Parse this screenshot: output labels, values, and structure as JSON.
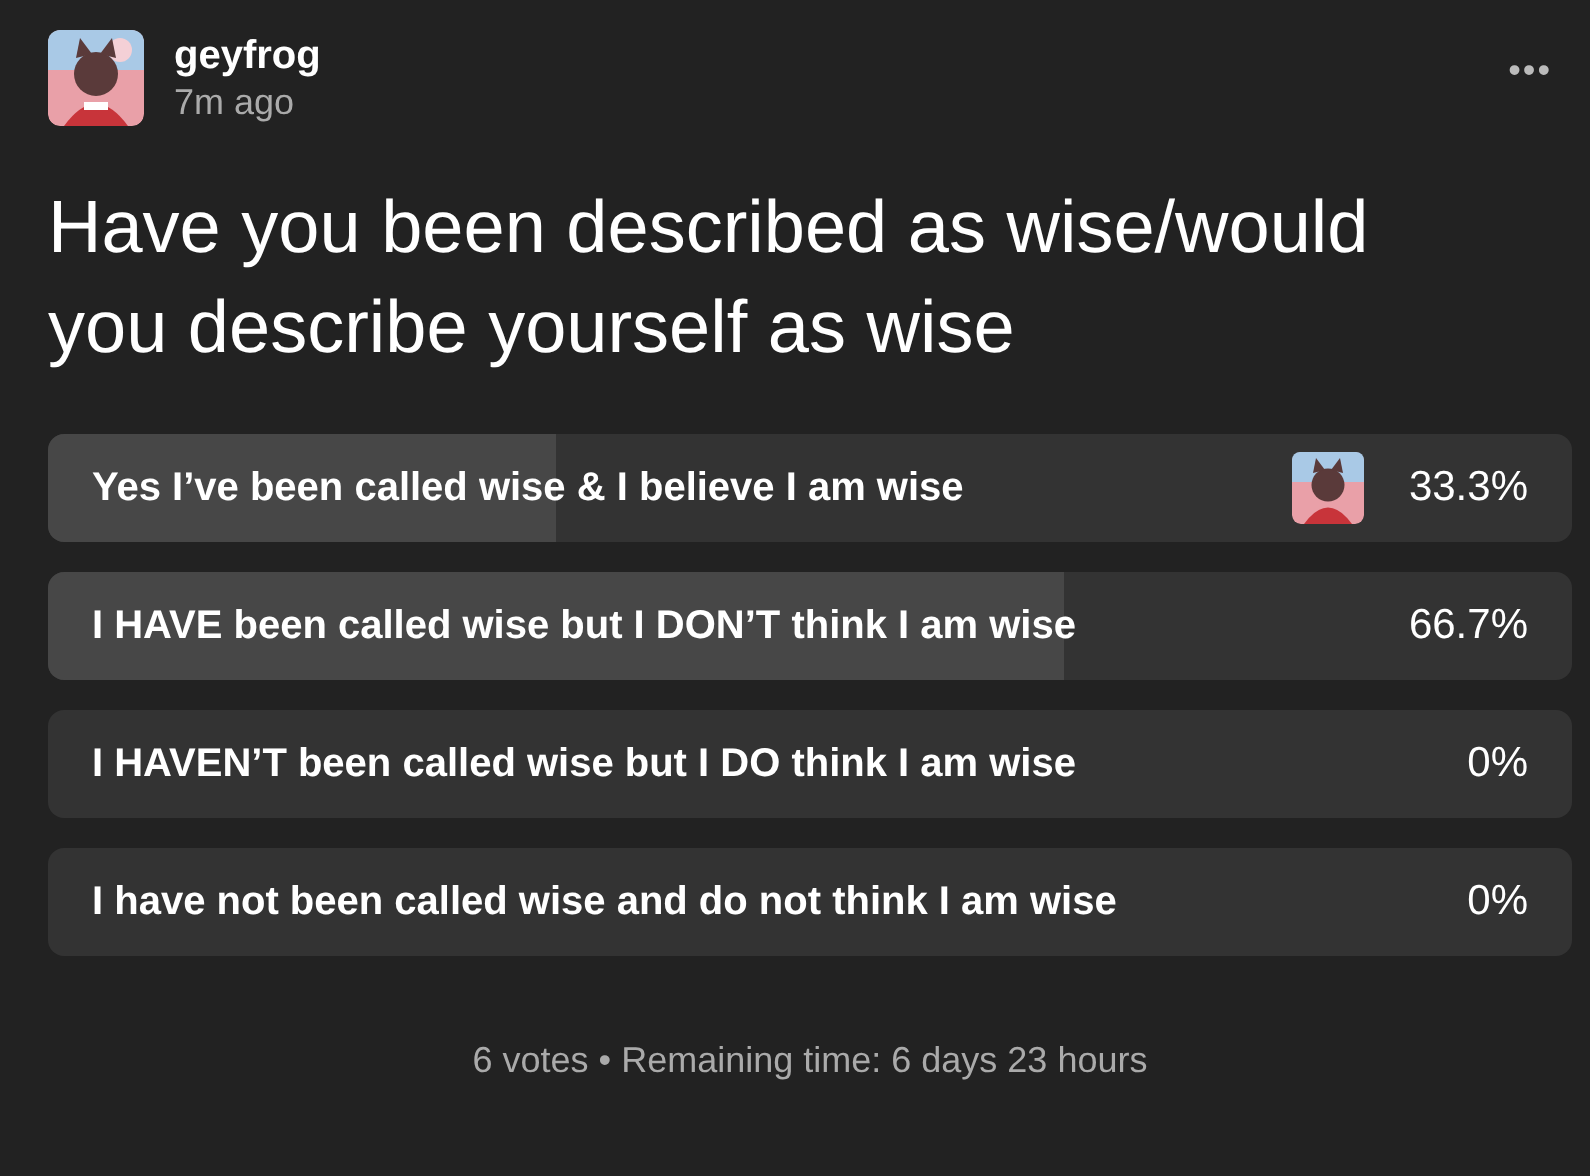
{
  "post": {
    "author": "geyfrog",
    "time": "7m ago",
    "menu": "•••"
  },
  "poll": {
    "question": "Have you been described as wise/would you describe yourself as wise",
    "options": [
      {
        "label": "Yes I’ve been called wise & I believe I am wise",
        "percent": "33.3%",
        "level": 0.333,
        "selected": true
      },
      {
        "label": "I HAVE been called wise but I DON’T think I am wise",
        "percent": "66.7%",
        "level": 0.667,
        "selected": false
      },
      {
        "label": "I HAVEN’T been called wise but I DO think I am wise",
        "percent": "0%",
        "selected": false
      },
      {
        "label": "I have not been called wise and do not think I am wise",
        "percent": "0%",
        "selected": false
      }
    ],
    "footer": "6 votes • Remaining time: 6 days 23 hours"
  }
}
